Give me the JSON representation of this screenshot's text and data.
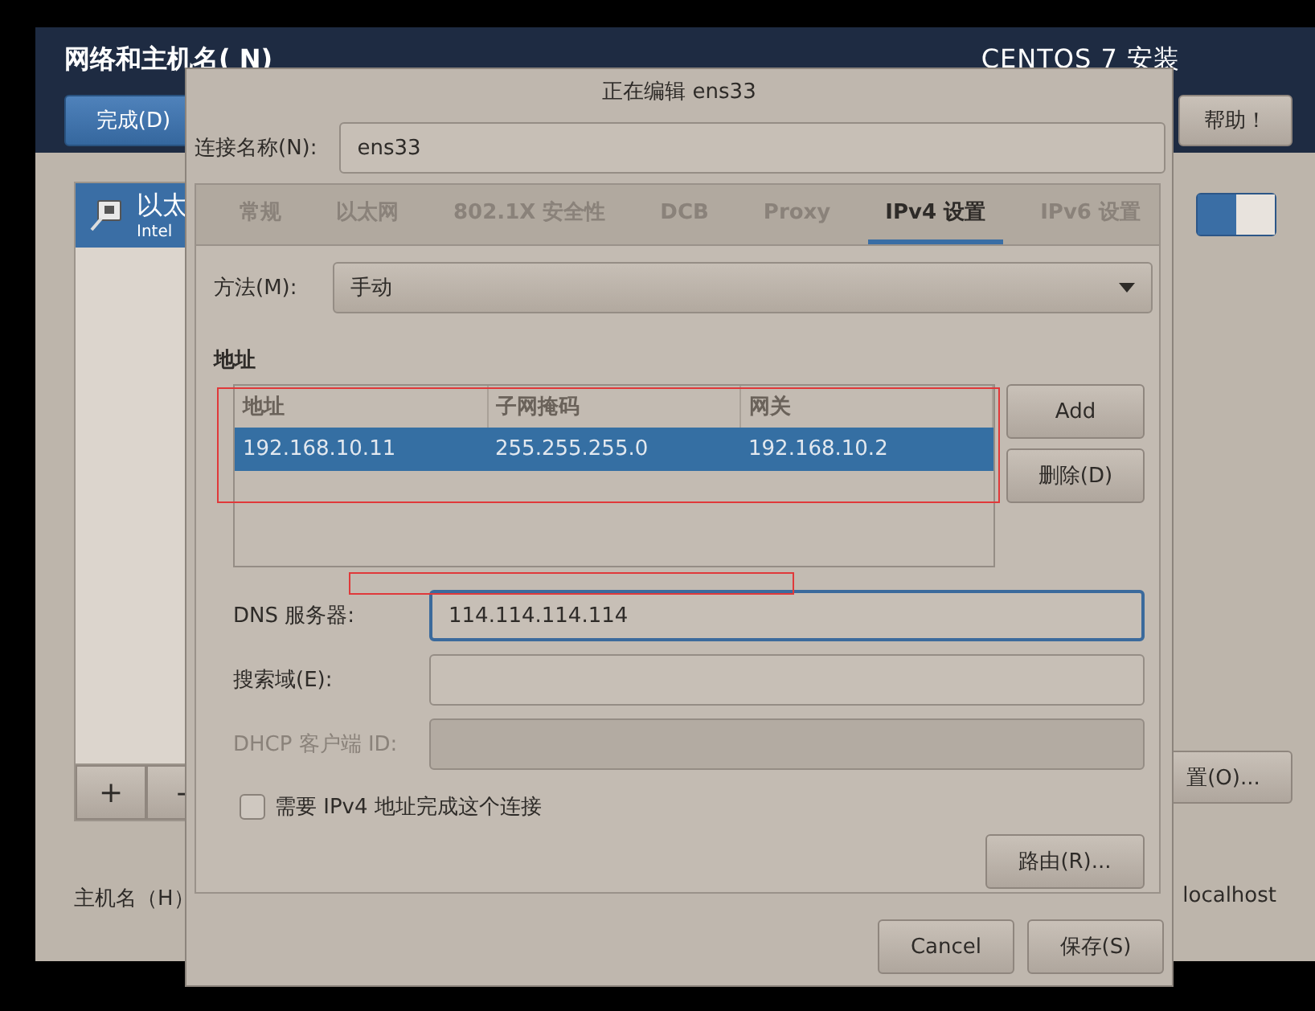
{
  "installer": {
    "title": "网络和主机名( N)",
    "product": "CENTOS 7 安装",
    "done_button": "完成(D)",
    "help_button": "帮助！",
    "devices": [
      {
        "name": "以太",
        "detail": "Intel",
        "selected": true
      }
    ],
    "device_switch": {
      "on": true
    },
    "add_button": "+",
    "remove_button": "-",
    "configure_button": "置(O)...",
    "hostname_label": "主机名（H）",
    "hostname_value": "localhost"
  },
  "dialog": {
    "title": "正在编辑 ens33",
    "name_label": "连接名称(N):",
    "name_value": "ens33",
    "tabs": [
      {
        "label": "常规",
        "selected": false
      },
      {
        "label": "以太网",
        "selected": false
      },
      {
        "label": "802.1X 安全性",
        "selected": false
      },
      {
        "label": "DCB",
        "selected": false
      },
      {
        "label": "Proxy",
        "selected": false
      },
      {
        "label": "IPv4 设置",
        "selected": true
      },
      {
        "label": "IPv6 设置",
        "selected": false
      }
    ],
    "method_label": "方法(M):",
    "method_value": "手动",
    "address_heading": "地址",
    "table": {
      "columns": [
        "地址",
        "子网掩码",
        "网关"
      ],
      "rows": [
        {
          "cells": [
            "192.168.10.11",
            "255.255.255.0",
            "192.168.10.2"
          ],
          "selected": true
        }
      ]
    },
    "add_button": "Add",
    "delete_button": "删除(D)",
    "fields": [
      {
        "label": "DNS 服务器:",
        "value": "114.114.114.114",
        "focused": true,
        "disabled": false
      },
      {
        "label": "搜索域(E):",
        "focused": false,
        "disabled": false
      },
      {
        "label": "DHCP 客户端 ID:",
        "focused": false,
        "disabled": true
      }
    ],
    "require_checkbox": {
      "label": "需要 IPv4 地址完成这个连接",
      "checked": false
    },
    "routes_button": "路由(R)...",
    "cancel_button": "Cancel",
    "save_button": "保存(S)"
  }
}
